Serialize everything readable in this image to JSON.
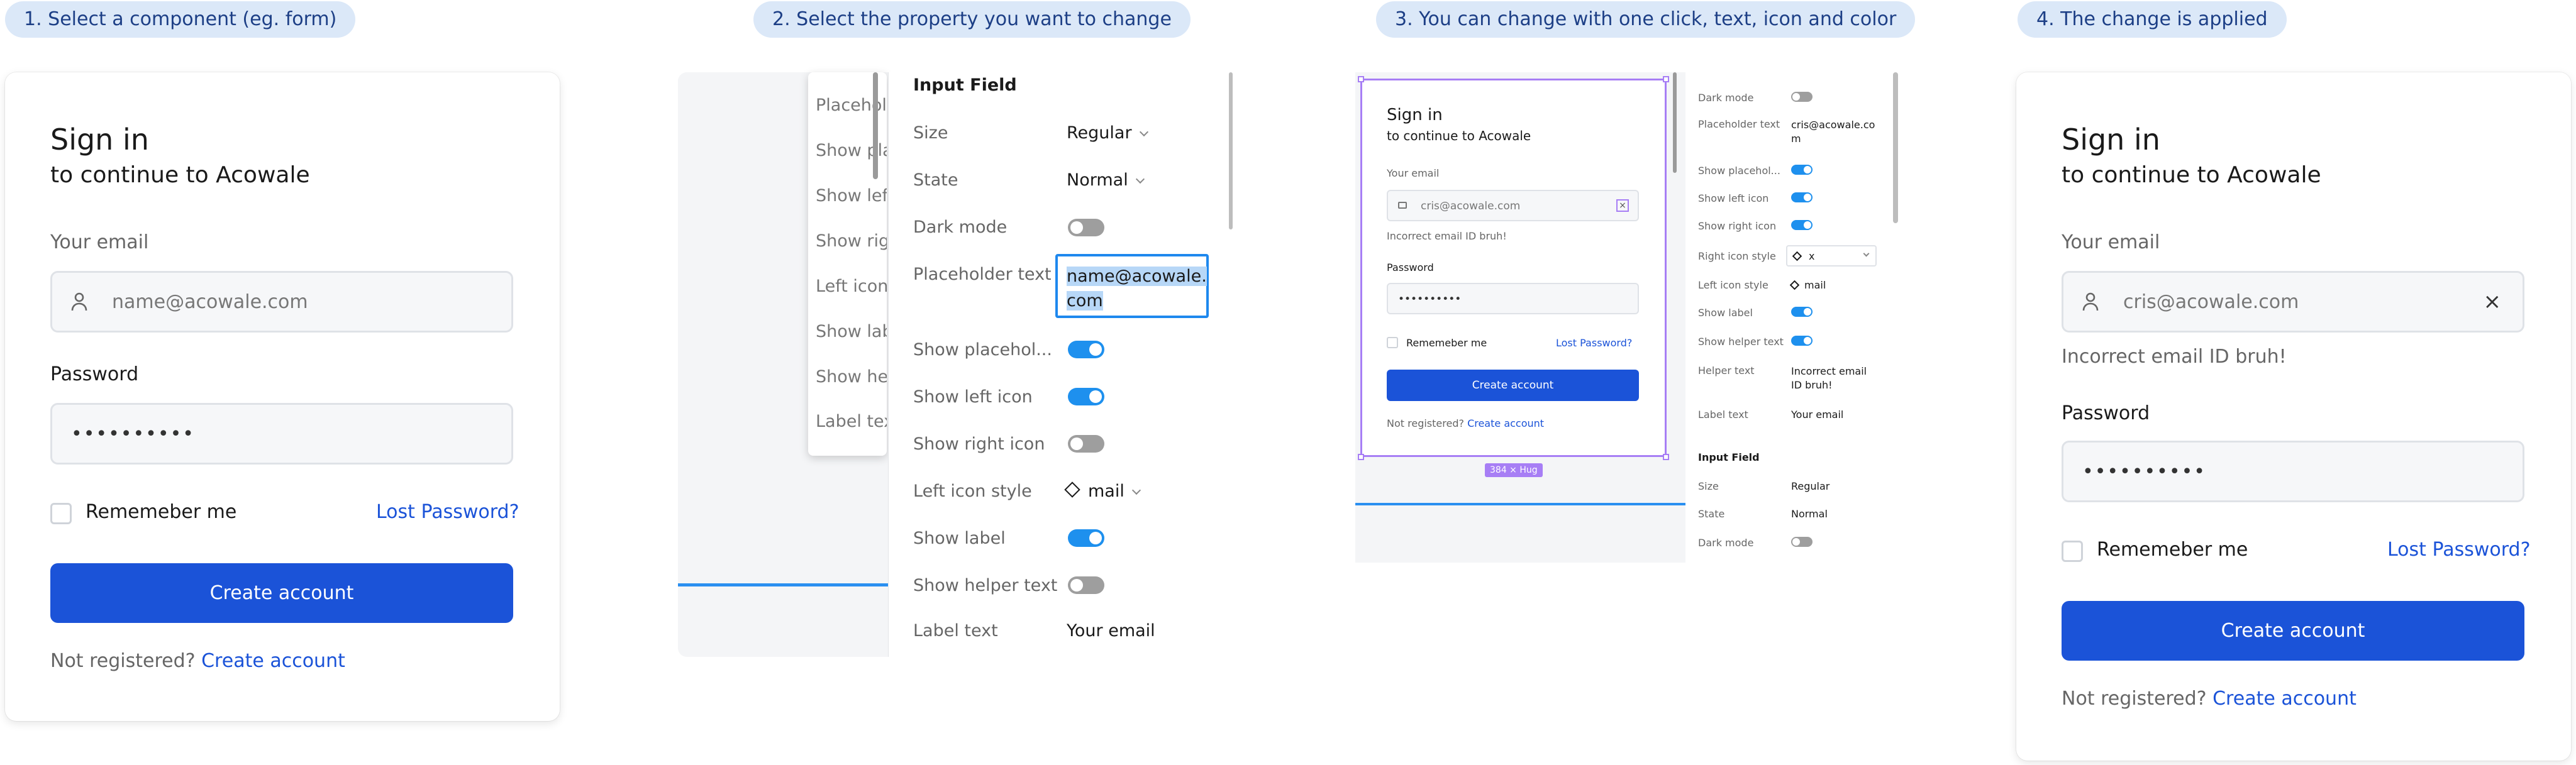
{
  "steps": [
    "1. Select a component (eg. form)",
    "2. Select the property you want to change",
    "3. You can change with one click, text, icon and color",
    "4. The change is applied"
  ],
  "form1": {
    "title": "Sign in",
    "subtitle": "to continue to Acowale",
    "email_label": "Your email",
    "email_placeholder": "name@acowale.com",
    "password_label": "Password",
    "password_value": "••••••••••",
    "remember_label": "Rememeber me",
    "lost_password": "Lost Password?",
    "create_button": "Create account",
    "not_registered": "Not registered?",
    "create_link": "Create account"
  },
  "panel2": {
    "left_rows": [
      "Placeholder",
      "Show plac",
      "Show left",
      "Show righ",
      "Left icon",
      "Show labe",
      "Show help",
      "Label text"
    ],
    "section_title": "Input Field",
    "props": [
      {
        "label": "Size",
        "value": "Regular",
        "kind": "select"
      },
      {
        "label": "State",
        "value": "Normal",
        "kind": "select"
      },
      {
        "label": "Dark mode",
        "value": "off",
        "kind": "toggle"
      },
      {
        "label": "Placeholder text",
        "value": "name@acowale.com",
        "kind": "text"
      },
      {
        "label": "Show placehol...",
        "value": "on",
        "kind": "toggle"
      },
      {
        "label": "Show left icon",
        "value": "on",
        "kind": "toggle"
      },
      {
        "label": "Show right icon",
        "value": "off",
        "kind": "toggle"
      },
      {
        "label": "Left icon style",
        "value": "mail",
        "kind": "icon-select"
      },
      {
        "label": "Show label",
        "value": "on",
        "kind": "toggle"
      },
      {
        "label": "Show helper text",
        "value": "off",
        "kind": "toggle"
      },
      {
        "label": "Label text",
        "value": "Your email",
        "kind": "text"
      }
    ],
    "placeholder_line1": "name@acowale.",
    "placeholder_line2": "com"
  },
  "panel3": {
    "title": "Sign in",
    "subtitle": "to continue to Acowale",
    "email_label": "Your email",
    "email_value": "cris@acowale.com",
    "error": "Incorrect email ID bruh!",
    "password_label": "Password",
    "password_value": "••••••••••",
    "remember_label": "Rememeber me",
    "lost_password": "Lost Password?",
    "create_button": "Create account",
    "not_registered": "Not registered?",
    "create_link": "Create account",
    "size_badge": "384 × Hug",
    "props": [
      {
        "label": "Dark mode",
        "value": "off",
        "kind": "toggle"
      },
      {
        "label": "Placeholder text",
        "value": "cris@acowale.co m",
        "kind": "text"
      },
      {
        "label": "Show placehol...",
        "value": "on",
        "kind": "toggle"
      },
      {
        "label": "Show left icon",
        "value": "on",
        "kind": "toggle"
      },
      {
        "label": "Show right icon",
        "value": "on",
        "kind": "toggle"
      },
      {
        "label": "Right icon style",
        "value": "x",
        "kind": "icon-select"
      },
      {
        "label": "Left icon style",
        "value": "mail",
        "kind": "icon-select"
      },
      {
        "label": "Show label",
        "value": "on",
        "kind": "toggle"
      },
      {
        "label": "Show helper text",
        "value": "on",
        "kind": "toggle"
      },
      {
        "label": "Helper text",
        "value": "Incorrect email ID bruh!",
        "kind": "text"
      },
      {
        "label": "Label text",
        "value": "Your email",
        "kind": "text"
      }
    ],
    "section2_title": "Input Field",
    "props2": [
      {
        "label": "Size",
        "value": "Regular",
        "kind": "select"
      },
      {
        "label": "State",
        "value": "Normal",
        "kind": "select"
      },
      {
        "label": "Dark mode",
        "value": "off",
        "kind": "toggle"
      }
    ]
  },
  "form4": {
    "title": "Sign in",
    "subtitle": "to continue to Acowale",
    "email_label": "Your email",
    "email_value": "cris@acowale.com",
    "error": "Incorrect email ID bruh!",
    "password_label": "Password",
    "password_value": "••••••••••",
    "remember_label": "Rememeber me",
    "lost_password": "Lost Password?",
    "create_button": "Create account",
    "not_registered": "Not registered?",
    "create_link": "Create account"
  },
  "colors": {
    "accent": "#1b53d8",
    "toggle_on": "#1e90ee",
    "selection": "#8b5cf6",
    "step_pill": "#dbe8f8"
  }
}
